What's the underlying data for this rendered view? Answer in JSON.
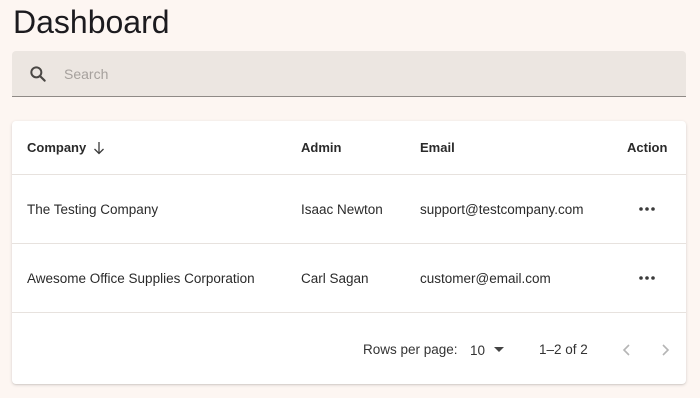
{
  "page": {
    "title": "Dashboard"
  },
  "search": {
    "placeholder": "Search",
    "value": "",
    "icon": "search-icon"
  },
  "table": {
    "columns": {
      "company": "Company",
      "admin": "Admin",
      "email": "Email",
      "action": "Action"
    },
    "sort": {
      "column": "company",
      "direction": "descending",
      "icon": "arrow-down-icon"
    },
    "rows": [
      {
        "company": "The Testing Company",
        "admin": "Isaac Newton",
        "email": "support@testcompany.com",
        "action_icon": "more-horizontal-icon"
      },
      {
        "company": "Awesome Office Supplies Corporation",
        "admin": "Carl Sagan",
        "email": "customer@email.com",
        "action_icon": "more-horizontal-icon"
      }
    ]
  },
  "pagination": {
    "rows_per_page_label": "Rows per page:",
    "rows_per_page_value": "10",
    "range_text": "1–2 of 2",
    "prev_icon": "chevron-left-icon",
    "next_icon": "chevron-right-icon"
  },
  "colors": {
    "background": "#fdf6f2",
    "search_bg": "#ece6e1",
    "card_bg": "#ffffff",
    "divider": "#e7e2de"
  }
}
